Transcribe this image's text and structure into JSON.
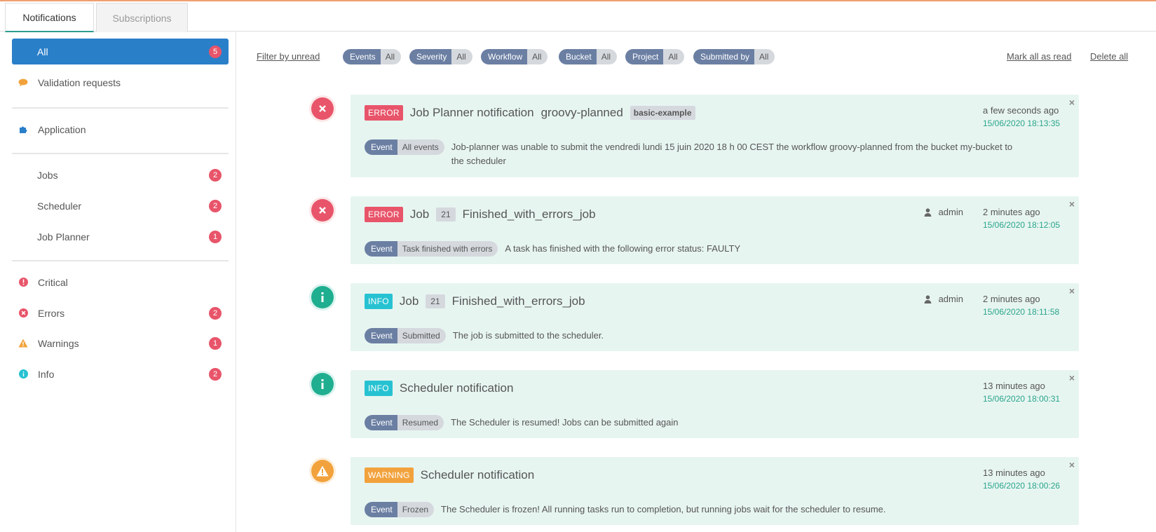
{
  "tabs": [
    {
      "label": "Notifications",
      "active": true
    },
    {
      "label": "Subscriptions",
      "active": false
    }
  ],
  "sidebar": {
    "all": {
      "label": "All",
      "count": "5"
    },
    "validation": {
      "label": "Validation requests",
      "icon": "comment-icon",
      "color": "#f2a23c"
    },
    "application": {
      "label": "Application",
      "icon": "puzzle-icon",
      "color": "#2a7fc9"
    },
    "jobs": {
      "label": "Jobs",
      "count": "2"
    },
    "scheduler": {
      "label": "Scheduler",
      "count": "2"
    },
    "jobplanner": {
      "label": "Job Planner",
      "count": "1"
    },
    "critical": {
      "label": "Critical",
      "icon": "exclamation-icon",
      "color": "#e8556a"
    },
    "errors": {
      "label": "Errors",
      "count": "2",
      "icon": "error-circle-icon",
      "color": "#e8556a"
    },
    "warnings": {
      "label": "Warnings",
      "count": "1",
      "icon": "warning-icon",
      "color": "#f2a23c"
    },
    "info": {
      "label": "Info",
      "count": "2",
      "icon": "info-icon",
      "color": "#27c2d2"
    }
  },
  "filters": {
    "filter_unread": "Filter by unread",
    "groups": [
      {
        "key": "Events",
        "value": "All"
      },
      {
        "key": "Severity",
        "value": "All"
      },
      {
        "key": "Workflow",
        "value": "All"
      },
      {
        "key": "Bucket",
        "value": "All"
      },
      {
        "key": "Project",
        "value": "All"
      },
      {
        "key": "Submitted by",
        "value": "All"
      }
    ],
    "mark_all_read": "Mark all as read",
    "delete_all": "Delete all"
  },
  "notifications": [
    {
      "severity": "ERROR",
      "title": "Job Planner notification",
      "workflow": "groovy-planned",
      "tag": "basic-example",
      "event_key": "Event",
      "event_value": "All events",
      "message": "Job-planner was unable to submit the vendredi lundi 15 juin 2020 18 h 00 CEST the workflow groovy-planned from the bucket my-bucket to the scheduler",
      "ago": "a few seconds ago",
      "date": "15/06/2020 18:13:35",
      "icon": "error-circle-icon"
    },
    {
      "severity": "ERROR",
      "title": "Job",
      "job_id": "21",
      "job_name": "Finished_with_errors_job",
      "user": "admin",
      "event_key": "Event",
      "event_value": "Task finished with errors",
      "message": "A task has finished with the following error status: FAULTY",
      "ago": "2 minutes ago",
      "date": "15/06/2020 18:12:05",
      "icon": "error-circle-icon"
    },
    {
      "severity": "INFO",
      "title": "Job",
      "job_id": "21",
      "job_name": "Finished_with_errors_job",
      "user": "admin",
      "event_key": "Event",
      "event_value": "Submitted",
      "message": "The job is submitted to the scheduler.",
      "ago": "2 minutes ago",
      "date": "15/06/2020 18:11:58",
      "icon": "info-icon"
    },
    {
      "severity": "INFO",
      "title": "Scheduler notification",
      "event_key": "Event",
      "event_value": "Resumed",
      "message": "The Scheduler is resumed! Jobs can be submitted again",
      "ago": "13 minutes ago",
      "date": "15/06/2020 18:00:31",
      "icon": "info-icon"
    },
    {
      "severity": "WARNING",
      "title": "Scheduler notification",
      "event_key": "Event",
      "event_value": "Frozen",
      "message": "The Scheduler is frozen! All running tasks run to completion, but running jobs wait for the scheduler to resume.",
      "ago": "13 minutes ago",
      "date": "15/06/2020 18:00:26",
      "icon": "warning-icon"
    }
  ],
  "close_glyph": "×",
  "colors": {
    "error": "#e8556a",
    "info": "#27c2d2",
    "warning": "#f2a23c",
    "accent": "#2a7fc9",
    "card_bg": "#e7f5f1"
  }
}
